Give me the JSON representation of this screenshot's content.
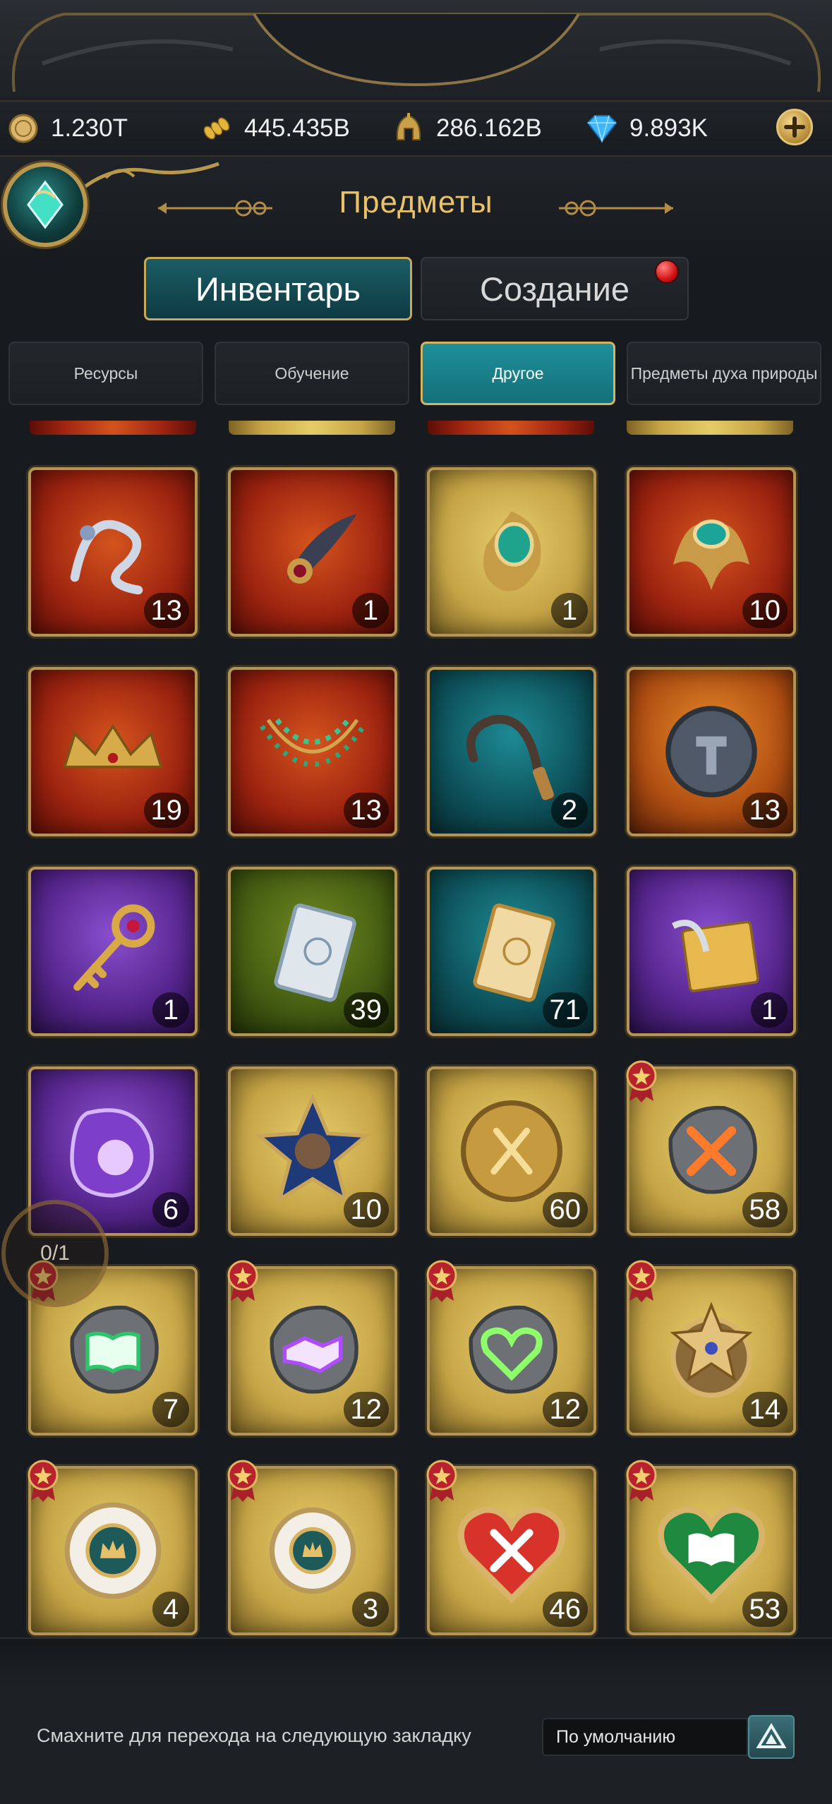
{
  "resources": [
    {
      "icon": "coin-icon",
      "value": "1.230T"
    },
    {
      "icon": "grain-icon",
      "value": "445.435B"
    },
    {
      "icon": "helmet-icon",
      "value": "286.162B"
    },
    {
      "icon": "diamond-icon",
      "value": "9.893K"
    }
  ],
  "header": {
    "title": "Предметы"
  },
  "main_tabs": [
    {
      "label": "Инвентарь",
      "active": true
    },
    {
      "label": "Создание",
      "active": false,
      "notification": true
    }
  ],
  "sub_tabs": [
    {
      "label": "Ресурсы"
    },
    {
      "label": "Обучение"
    },
    {
      "label": "Другое",
      "active": true
    },
    {
      "label": "Предметы духа природы"
    }
  ],
  "items": [
    {
      "icon": "silver-dragon-icon",
      "count": "13",
      "bg": "red"
    },
    {
      "icon": "feather-brooch-icon",
      "count": "1",
      "bg": "red"
    },
    {
      "icon": "emerald-brooch-icon",
      "count": "1",
      "bg": "gold"
    },
    {
      "icon": "emerald-ornament-icon",
      "count": "10",
      "bg": "red"
    },
    {
      "icon": "golden-crown-icon",
      "count": "19",
      "bg": "red"
    },
    {
      "icon": "jade-necklace-icon",
      "count": "13",
      "bg": "red"
    },
    {
      "icon": "whip-icon",
      "count": "2",
      "bg": "teal"
    },
    {
      "icon": "hammer-coin-icon",
      "count": "13",
      "bg": "orange"
    },
    {
      "icon": "golden-key-icon",
      "count": "1",
      "bg": "purple"
    },
    {
      "icon": "silver-card-icon",
      "count": "39",
      "bg": "green"
    },
    {
      "icon": "golden-card-icon",
      "count": "71",
      "bg": "teal"
    },
    {
      "icon": "scroll-quill-icon",
      "count": "1",
      "bg": "purple"
    },
    {
      "icon": "purple-gem-icon",
      "count": "6",
      "bg": "purple"
    },
    {
      "icon": "hero-star-icon",
      "count": "10",
      "bg": "gold"
    },
    {
      "icon": "gold-medal-icon",
      "count": "60",
      "bg": "gold"
    },
    {
      "icon": "swords-rune-icon",
      "count": "58",
      "bg": "gold",
      "badge": true
    },
    {
      "icon": "book-rune-icon",
      "count": "7",
      "bg": "gold",
      "badge": true
    },
    {
      "icon": "handshake-rune-icon",
      "count": "12",
      "bg": "gold",
      "badge": true
    },
    {
      "icon": "heart-rune-icon",
      "count": "12",
      "bg": "gold",
      "badge": true
    },
    {
      "icon": "star-medal-icon",
      "count": "14",
      "bg": "gold",
      "badge": true
    },
    {
      "icon": "crown-medal-icon",
      "count": "4",
      "bg": "gold",
      "badge": true
    },
    {
      "icon": "crown-medal-small-icon",
      "count": "3",
      "bg": "gold",
      "badge": true
    },
    {
      "icon": "swords-heart-icon",
      "count": "46",
      "bg": "gold",
      "badge": true
    },
    {
      "icon": "book-heart-icon",
      "count": "53",
      "bg": "gold",
      "badge": true
    }
  ],
  "progress": {
    "text": "0/1"
  },
  "footer": {
    "hint": "Смахните для перехода на следующую закладку",
    "sort": "По умолчанию"
  }
}
